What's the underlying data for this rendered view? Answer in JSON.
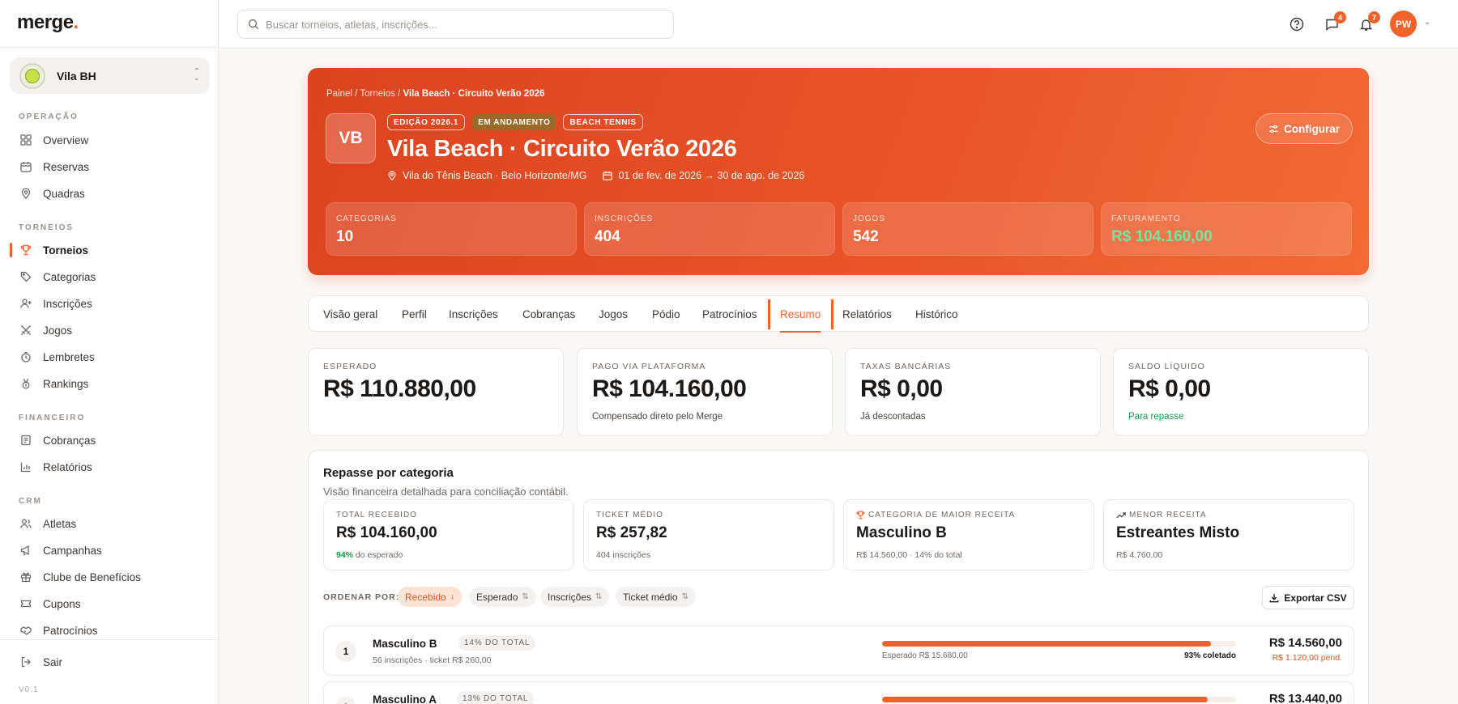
{
  "sidebar": {
    "logo": "merge",
    "logo_dot": ".",
    "org_name": "Vila BH",
    "sections": {
      "operacao": "OPERAÇÃO",
      "torneios": "TORNEIOS",
      "financeiro": "FINANCEIRO",
      "crm": "CRM"
    },
    "items": {
      "overview": "Overview",
      "reservas": "Reservas",
      "quadras": "Quadras",
      "torneios": "Torneios",
      "categorias": "Categorias",
      "inscricoes": "Inscrições",
      "jogos": "Jogos",
      "lembretes": "Lembretes",
      "rankings": "Rankings",
      "cobrancas": "Cobranças",
      "relatorios": "Relatórios",
      "atletas": "Atletas",
      "campanhas": "Campanhas",
      "clube": "Clube de Benefícios",
      "cupons": "Cupons",
      "patrocinios": "Patrocínios"
    },
    "logout": "Sair",
    "version": "V0.1"
  },
  "topbar": {
    "search_placeholder": "Buscar torneios, atletas, inscrições...",
    "messages_count": "4",
    "notifications_count": "7",
    "user_initials": "PW"
  },
  "hero": {
    "breadcrumb": {
      "painel": "Painel",
      "sep": "/",
      "torneios": "Torneios",
      "current": "Vila Beach · Circuito Verão 2026"
    },
    "badge": "VB",
    "tags": {
      "edition": "EDIÇÃO 2026.1",
      "status": "EM ANDAMENTO",
      "sport": "BEACH TENNIS"
    },
    "title": "Vila Beach · Circuito Verão 2026",
    "location": "Vila do Tênis Beach · Belo Horizonte/MG",
    "dates": "01 de fev. de 2026 → 30 de ago. de 2026",
    "config_label": "Configurar",
    "stats": {
      "categorias": {
        "label": "CATEGORIAS",
        "value": "10"
      },
      "inscricoes": {
        "label": "INSCRIÇÕES",
        "value": "404"
      },
      "jogos": {
        "label": "JOGOS",
        "value": "542"
      },
      "faturamento": {
        "label": "FATURAMENTO",
        "value": "R$ 104.160,00"
      }
    }
  },
  "tabs": {
    "visao": "Visão geral",
    "perfil": "Perfil",
    "inscricoes": "Inscrições",
    "cobrancas": "Cobranças",
    "jogos": "Jogos",
    "podio": "Pódio",
    "patrocinios": "Patrocínios",
    "resumo": "Resumo",
    "relatorios": "Relatórios",
    "historico": "Histórico"
  },
  "kpis": {
    "esperado": {
      "label": "ESPERADO",
      "value": "R$ 110.880,00"
    },
    "pago": {
      "label": "PAGO VIA PLATAFORMA",
      "value": "R$ 104.160,00",
      "sub": "Compensado direto pelo Merge"
    },
    "taxas": {
      "label": "TAXAS BANCÁRIAS",
      "value": "R$ 0,00",
      "sub": "Já descontadas"
    },
    "saldo": {
      "label": "SALDO LÍQUIDO",
      "value": "R$ 0,00",
      "sub": "Para repasse"
    }
  },
  "repasse": {
    "title": "Repasse por categoria",
    "subtitle": "Visão financeira detalhada para conciliação contábil.",
    "cards": {
      "total": {
        "label": "TOTAL RECEBIDO",
        "value": "R$ 104.160,00",
        "pct": "94%",
        "sub": " do esperado"
      },
      "ticket": {
        "label": "TICKET MÉDIO",
        "value": "R$ 257,82",
        "sub": "404 inscrições"
      },
      "maior": {
        "label": "CATEGORIA DE MAIOR RECEITA",
        "value": "Masculino B",
        "sub": "R$ 14.560,00 · 14% do total"
      },
      "menor": {
        "label": "MENOR RECEITA",
        "value": "Estreantes Misto",
        "sub": "R$ 4.760,00"
      }
    },
    "sort": {
      "label": "ORDENAR POR:",
      "recebido": "Recebido",
      "recebido_arrow": "↓",
      "esperado": "Esperado",
      "inscricoes": "Inscrições",
      "ticket": "Ticket médio",
      "neutral_arrow": "⇅"
    },
    "export_label": "Exportar CSV",
    "rows": [
      {
        "rank": "1",
        "name": "Masculino B",
        "share": "14% DO TOTAL",
        "meta": "56 inscrições · ticket R$ 260,00",
        "progress": 0.93,
        "expected": "Esperado R$ 15.680,00",
        "collected": "93% coletado",
        "amount": "R$ 14.560,00",
        "pending": "R$ 1.120,00 pend."
      },
      {
        "rank": "2",
        "name": "Masculino A",
        "share": "13% DO TOTAL",
        "meta": "",
        "progress": 0.92,
        "expected": "",
        "collected": "",
        "amount": "R$ 13.440,00",
        "pending": ""
      }
    ]
  }
}
